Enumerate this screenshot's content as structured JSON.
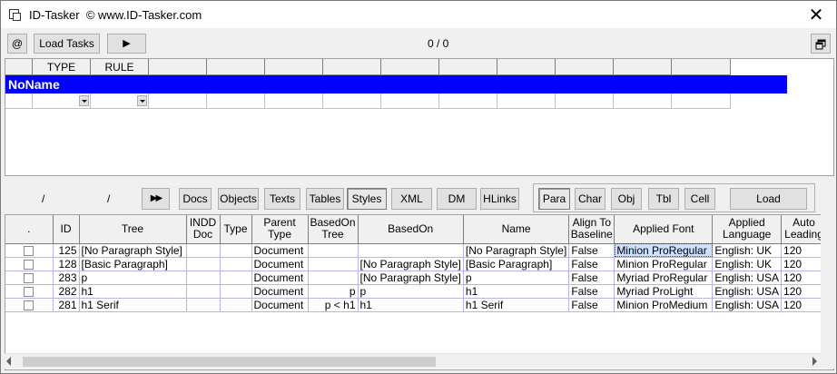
{
  "window": {
    "title": "ID-Tasker",
    "subtitle": "© www.ID-Tasker.com",
    "close": "✕"
  },
  "toolbar": {
    "at_label": "@",
    "load_tasks_label": "Load Tasks",
    "play_label": "▶",
    "counter": "0 / 0",
    "restore_icon": "restore-window-icon"
  },
  "task_grid": {
    "columns": [
      "",
      "TYPE",
      "RULE",
      "",
      "",
      "",
      "",
      "",
      "",
      "",
      "",
      "",
      ""
    ],
    "row_label": "NoName",
    "row_color": "#0000ff"
  },
  "nav": {
    "slash1": "/",
    "slash2": "/",
    "forward_label": "▶▶",
    "tabs": [
      "Docs",
      "Objects",
      "Texts",
      "Tables",
      "Styles",
      "XML",
      "DM",
      "HLinks"
    ],
    "active_tab": "Styles",
    "subtabs": [
      "Para",
      "Char",
      "Obj",
      "Tbl",
      "Cell"
    ],
    "active_subtab": "Para",
    "load_label": "Load"
  },
  "styles_grid": {
    "headers": [
      ".",
      "ID",
      "Tree",
      "INDD Doc",
      "Type",
      "Parent Type",
      "BasedOn Tree",
      "BasedOn",
      "Name",
      "Align To Baseline",
      "Applied Font",
      "Applied Language",
      "Auto Leading"
    ],
    "rows": [
      {
        "id": "125",
        "tree": "[No Paragraph Style]",
        "indd_doc": "",
        "type": "",
        "parent_type": "Document",
        "basedon_tree": "",
        "basedon": "",
        "name": "[No Paragraph Style]",
        "align": "False",
        "font": "Minion ProRegular",
        "language": "English: UK",
        "leading": "120"
      },
      {
        "id": "128",
        "tree": "[Basic Paragraph]",
        "indd_doc": "",
        "type": "",
        "parent_type": "Document",
        "basedon_tree": "",
        "basedon": "[No Paragraph Style]",
        "name": "[Basic Paragraph]",
        "align": "False",
        "font": "Minion ProRegular",
        "language": "English: UK",
        "leading": "120"
      },
      {
        "id": "283",
        "tree": "p",
        "indd_doc": "",
        "type": "",
        "parent_type": "Document",
        "basedon_tree": "",
        "basedon": "[No Paragraph Style]",
        "name": "p",
        "align": "False",
        "font": "Myriad ProRegular",
        "language": "English: USA",
        "leading": "120"
      },
      {
        "id": "282",
        "tree": "h1",
        "indd_doc": "",
        "type": "",
        "parent_type": "Document",
        "basedon_tree": "p",
        "basedon": "p",
        "name": "h1",
        "align": "False",
        "font": "Myriad ProLight",
        "language": "English: USA",
        "leading": "120"
      },
      {
        "id": "281",
        "tree": "h1 Serif",
        "indd_doc": "",
        "type": "",
        "parent_type": "Document",
        "basedon_tree": "p < h1",
        "basedon": "h1",
        "name": "h1 Serif",
        "align": "False",
        "font": "Minion ProMedium",
        "language": "English: USA",
        "leading": "120"
      }
    ]
  }
}
